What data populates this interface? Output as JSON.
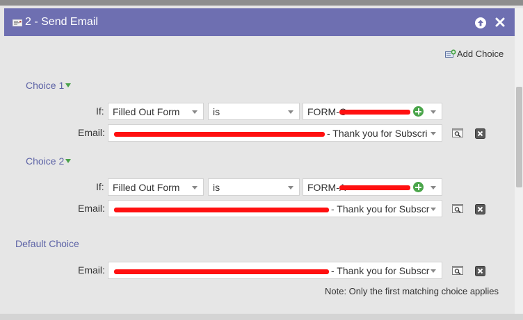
{
  "dialog": {
    "title": "2 - Send Email",
    "add_choice_label": "Add Choice"
  },
  "choices": [
    {
      "label": "Choice 1",
      "if_label": "If:",
      "condition": "Filled Out Form",
      "operator": "is",
      "value": "FORM-C",
      "email_label": "Email:",
      "email_value": "- Thank you for Subscri"
    },
    {
      "label": "Choice 2",
      "if_label": "If:",
      "condition": "Filled Out Form",
      "operator": "is",
      "value": "FORM-A",
      "email_label": "Email:",
      "email_value": "- Thank you for Subscr"
    }
  ],
  "default_choice": {
    "label": "Default Choice",
    "email_label": "Email:",
    "email_value": "- Thank you for Subscr"
  },
  "note": "Note: Only the first matching choice applies",
  "colors": {
    "titlebar": "#6e6fb1",
    "choice_label": "#5d63a6",
    "add_icon": "#4aa54a",
    "redaction": "#ff1010"
  },
  "icons": {
    "title": "email-icon",
    "collapse": "arrow-up-icon",
    "close": "close-icon",
    "add_choice": "add-choice-icon",
    "add_value": "plus-circle-icon",
    "preview": "preview-icon",
    "delete": "delete-icon"
  }
}
